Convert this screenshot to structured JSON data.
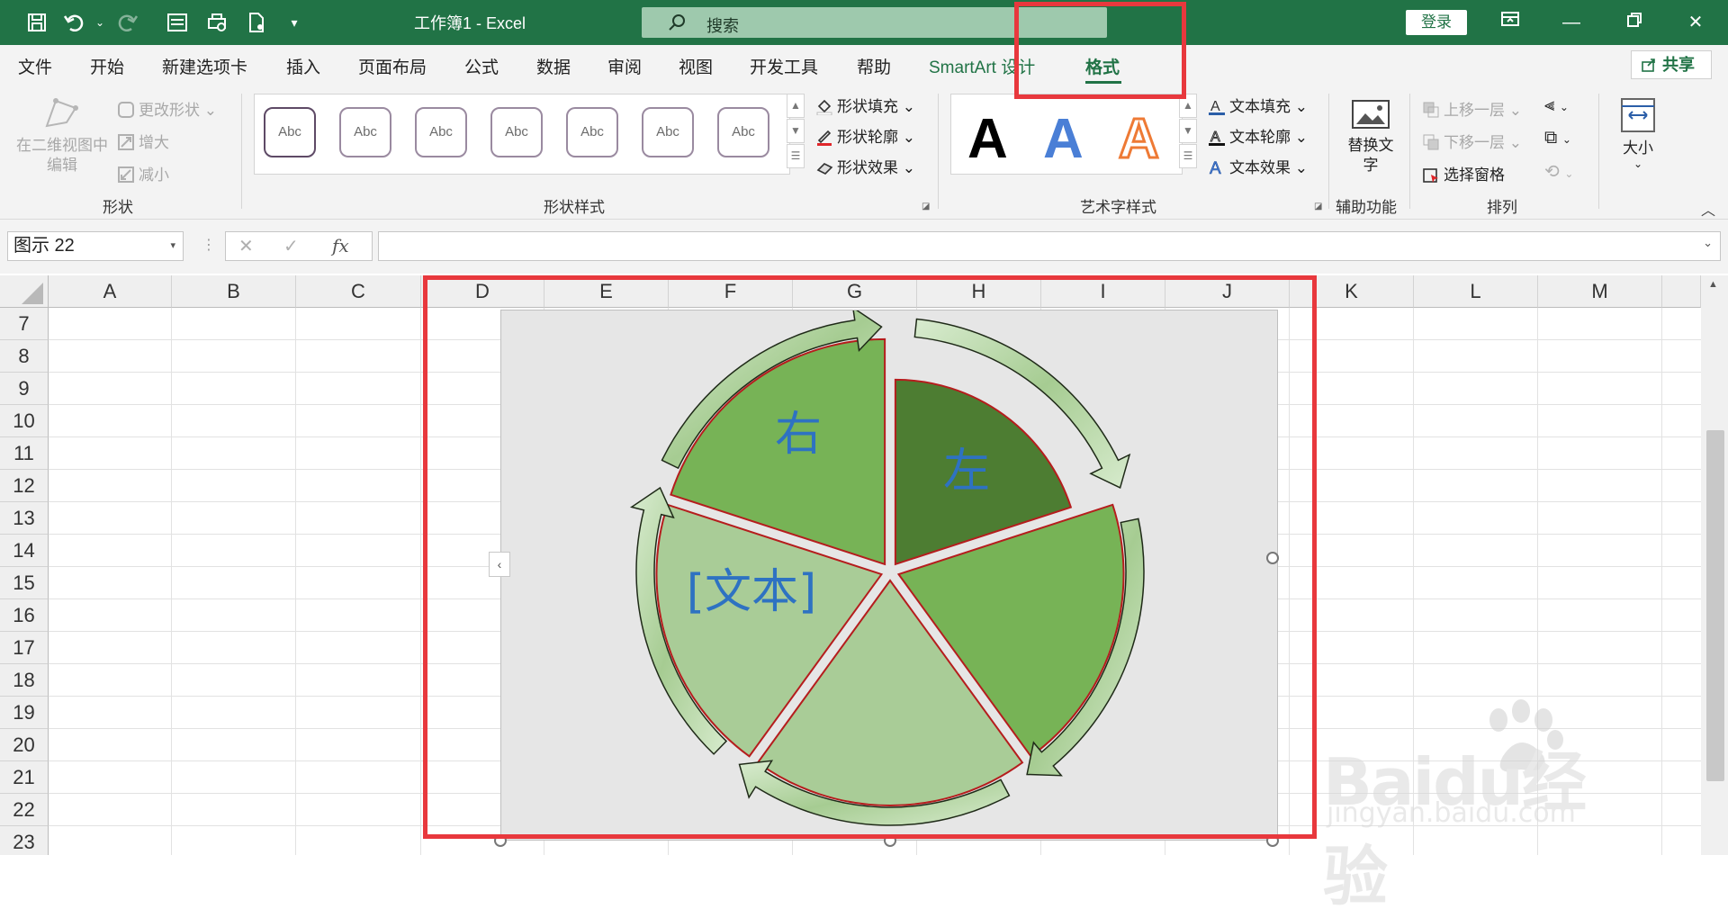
{
  "titlebar": {
    "doc_title": "工作簿1  -  Excel",
    "search_placeholder": "搜索",
    "login_label": "登录"
  },
  "tabs": [
    {
      "label": "文件"
    },
    {
      "label": "开始"
    },
    {
      "label": "新建选项卡"
    },
    {
      "label": "插入"
    },
    {
      "label": "页面布局"
    },
    {
      "label": "公式"
    },
    {
      "label": "数据"
    },
    {
      "label": "审阅"
    },
    {
      "label": "视图"
    },
    {
      "label": "开发工具"
    },
    {
      "label": "帮助"
    },
    {
      "label": "SmartArt 设计"
    },
    {
      "label": "格式"
    }
  ],
  "share_label": "共享",
  "ribbon": {
    "shapes": {
      "edit_in_2d": "在二维视图中编辑",
      "change_shape": "更改形状",
      "larger": "增大",
      "smaller": "减小",
      "group_label": "形状"
    },
    "shape_styles": {
      "thumb_label": "Abc",
      "fill": "形状填充",
      "outline": "形状轮廓",
      "effects": "形状效果",
      "group_label": "形状样式"
    },
    "wordart": {
      "letter": "A",
      "text_fill": "文本填充",
      "text_outline": "文本轮廓",
      "text_effects": "文本效果",
      "group_label": "艺术字样式"
    },
    "accessibility": {
      "alt_text": "替换文字",
      "group_label": "辅助功能"
    },
    "arrange": {
      "bring_forward": "上移一层",
      "send_backward": "下移一层",
      "selection_pane": "选择窗格",
      "group_label": "排列"
    },
    "size": {
      "label": "大小"
    }
  },
  "formula_bar": {
    "name_box": "图示 22",
    "fx": "fx",
    "formula": ""
  },
  "columns": [
    "A",
    "B",
    "C",
    "D",
    "E",
    "F",
    "G",
    "H",
    "I",
    "J",
    "K",
    "L",
    "M"
  ],
  "rows": [
    "7",
    "8",
    "9",
    "10",
    "11",
    "12",
    "13",
    "14",
    "15",
    "16",
    "17",
    "18",
    "19",
    "20",
    "21",
    "22",
    "23"
  ],
  "smartart": {
    "segment_right": "右",
    "segment_left": "左",
    "segment_text": "[文本]",
    "colors": {
      "dark": "#4d7d32",
      "mid": "#77b356",
      "light": "#a9cc97",
      "text": "#2e72c2"
    }
  },
  "watermark": {
    "brand": "Baidu经验",
    "url": "jingyan.baidu.com"
  }
}
